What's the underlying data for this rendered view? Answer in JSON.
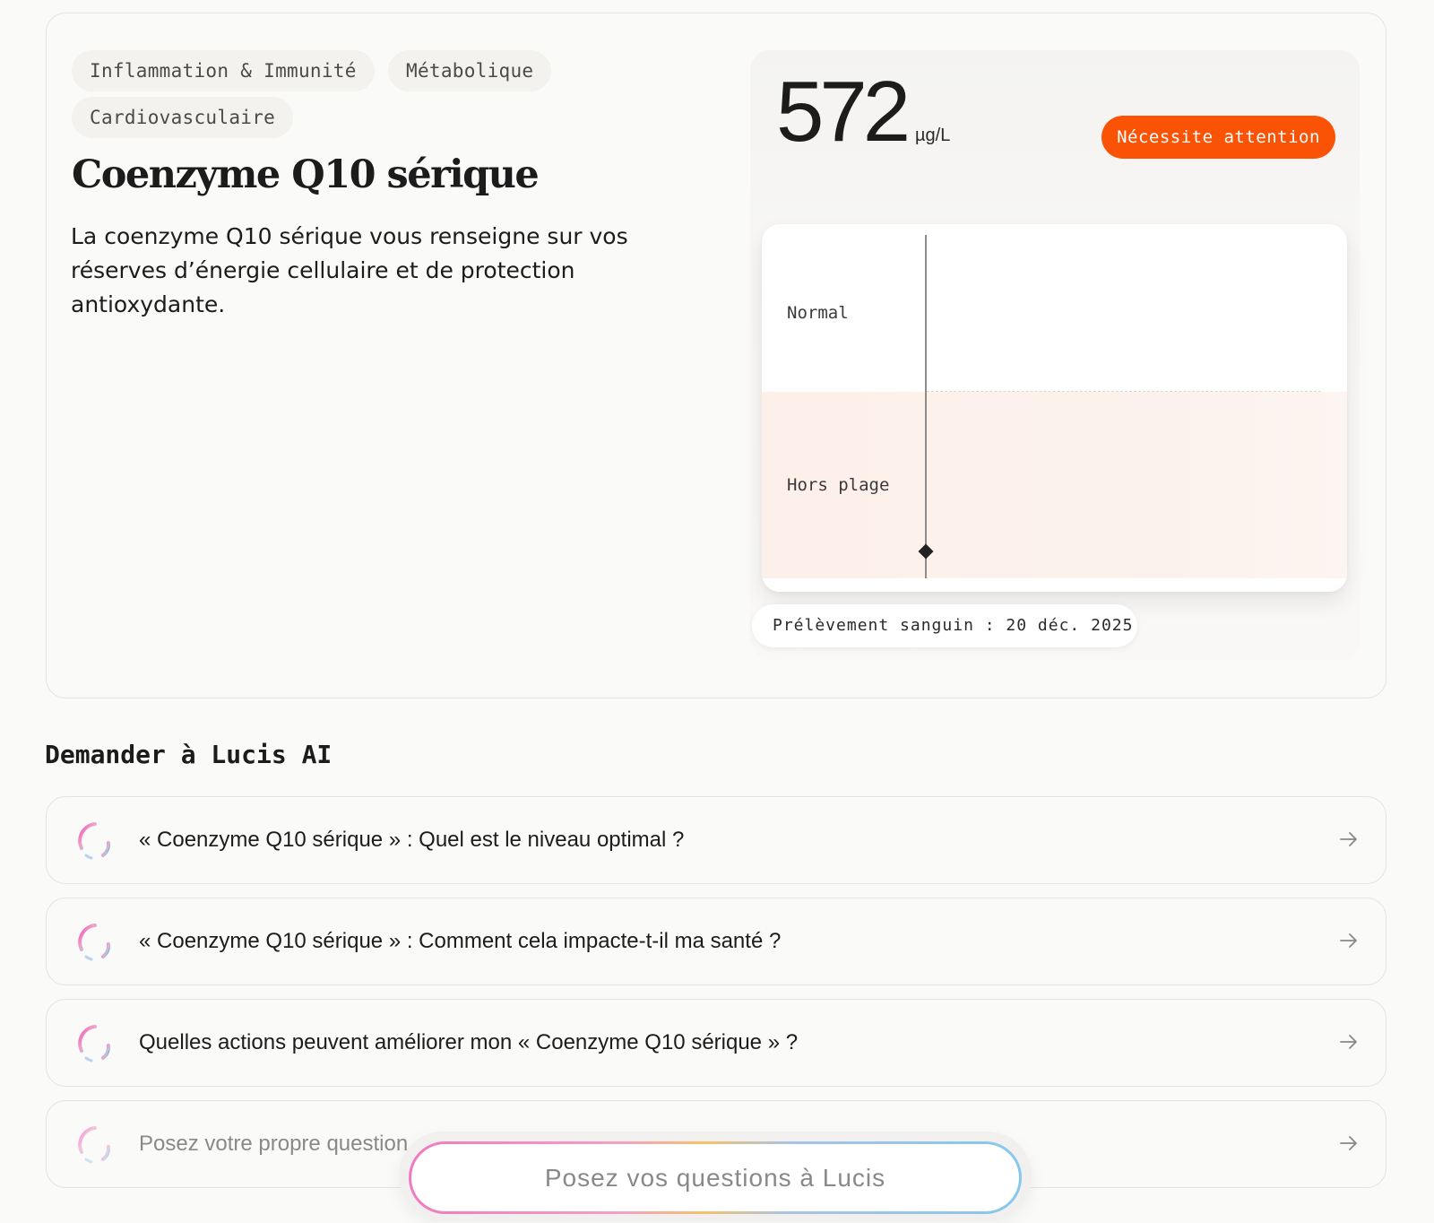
{
  "biomarker": {
    "tags": [
      "Inflammation & Immunité",
      "Métabolique",
      "Cardiovasculaire"
    ],
    "title": "Coenzyme Q10 sérique",
    "description": "La coenzyme Q10 sérique vous renseigne sur vos réserves d’énergie cellulaire et de protection antioxydante."
  },
  "result": {
    "value": "572",
    "unit": "µg/L",
    "status": "Nécessite attention",
    "status_color": "#fa5305",
    "zones": {
      "normal": "Normal",
      "out": "Hors plage"
    },
    "sample_date": "Prélèvement sanguin : 20 déc. 2025"
  },
  "ask": {
    "section_title": "Demander à Lucis AI",
    "questions": [
      "« Coenzyme Q10 sérique » : Quel est le niveau optimal ?",
      "« Coenzyme Q10 sérique » : Comment cela impacte-t-il ma santé ?",
      "Quelles actions peuvent améliorer mon « Coenzyme Q10 sérique » ?"
    ],
    "own_question_placeholder": "Posez votre propre question",
    "icons": {
      "question": "ai-spinner-icon",
      "arrow": "arrow-right-icon"
    },
    "floating_placeholder": "Posez vos questions à Lucis"
  }
}
